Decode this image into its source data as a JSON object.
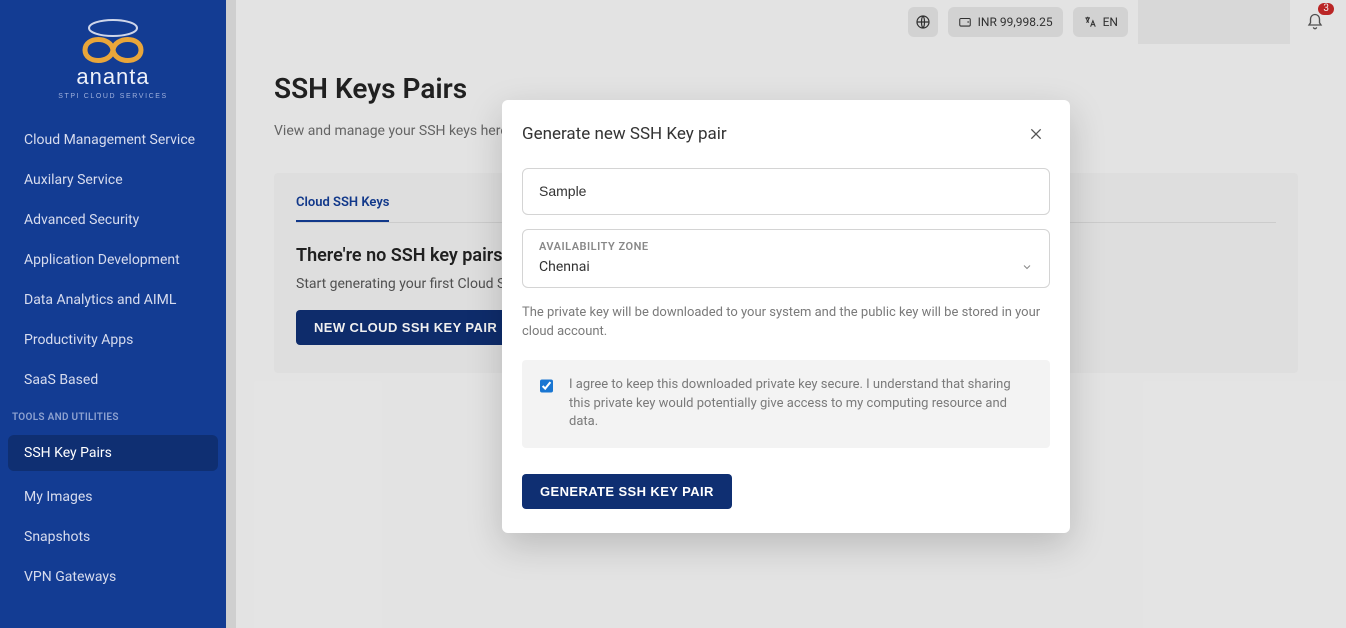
{
  "brand": {
    "name": "ananta",
    "tagline": "STPI CLOUD SERVICES"
  },
  "topbar": {
    "balance": "INR 99,998.25",
    "language": "EN",
    "notification_count": "3"
  },
  "sidebar": {
    "items": [
      {
        "label": "Cloud Management Service"
      },
      {
        "label": "Auxilary Service"
      },
      {
        "label": "Advanced Security"
      },
      {
        "label": "Application Development"
      },
      {
        "label": "Data Analytics and AIML"
      },
      {
        "label": "Productivity Apps"
      },
      {
        "label": "SaaS Based"
      }
    ],
    "section_label": "TOOLS AND UTILITIES",
    "tools": [
      {
        "label": "SSH Key Pairs",
        "active": true
      },
      {
        "label": "My Images"
      },
      {
        "label": "Snapshots"
      },
      {
        "label": "VPN Gateways"
      }
    ]
  },
  "page": {
    "title": "SSH Keys Pairs",
    "subtitle": "View and manage your SSH keys here. The public keys of the generated/imported key-pairs are stored on Ananta Cloud.",
    "tabs": [
      {
        "label": "Cloud SSH Keys",
        "active": true
      }
    ],
    "empty_title": "There're no SSH key pairs yet",
    "empty_sub": "Start generating your first Cloud SSH Key Pair.",
    "new_button": "NEW CLOUD SSH KEY PAIR"
  },
  "modal": {
    "title": "Generate new SSH Key pair",
    "name_value": "Sample",
    "zone_label": "AVAILABILITY ZONE",
    "zone_value": "Chennai",
    "helper": "The private key will be downloaded to your system and the public key will be stored in your cloud account.",
    "ack": "I agree to keep this downloaded private key secure. I understand that sharing this private key would potentially give access to my computing resource and data.",
    "submit": "GENERATE SSH KEY PAIR",
    "ack_checked": true
  }
}
